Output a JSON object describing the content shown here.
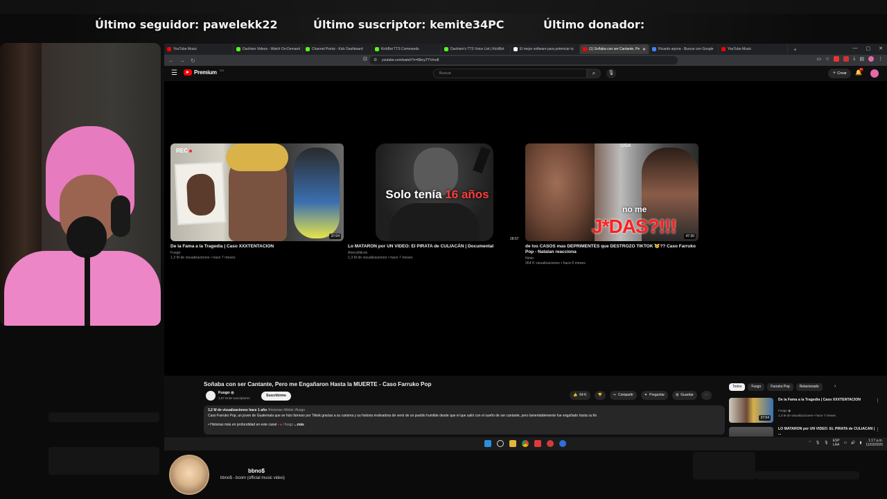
{
  "overlay": {
    "follower": "Último seguidor: pawelekk22",
    "subscriber": "Último suscriptor: kemite34PC",
    "donor": "Último donador:"
  },
  "browser": {
    "tabs": [
      {
        "label": "YouTube Music",
        "color": "#ff0000"
      },
      {
        "label": "Dashism Videos - Watch On-Demand",
        "color": "#53fc18"
      },
      {
        "label": "Channel Points - Kick Dashboard",
        "color": "#53fc18"
      },
      {
        "label": "KickBot TTS Commands",
        "color": "#53fc18"
      },
      {
        "label": "Dashism's TTS Voice List | KickBot",
        "color": "#53fc18"
      },
      {
        "label": "El mejor software para potenciar tu",
        "color": "#ffffff"
      },
      {
        "label": "(1) Soñaba con ser Cantante, Pe",
        "color": "#ff0000"
      },
      {
        "label": "Ricardo arjona - Buscar con Google",
        "color": "#4285f4"
      },
      {
        "label": "YouTube Music",
        "color": "#ff0000"
      }
    ],
    "active_tab": 6,
    "url": "youtube.com/watch?v=6lbcyTYVmo8"
  },
  "youtube": {
    "logo_text": "Premium",
    "logo_cc": "CO",
    "search_placeholder": "Buscar",
    "create_label": "Crear",
    "notif_count": "9+"
  },
  "end_cards": [
    {
      "title": "De la Fama a la Tragedia | Caso XXXTENTACION",
      "channel": "Fusgo",
      "meta": "1,3 M de visualizaciones • hace 7 meses",
      "duration": "37:04",
      "overlay_text": "REC"
    },
    {
      "title": "Lo MATARON por UN VIDEO: El PIRATA de CULIACÁN | Documental",
      "channel": "Anecdóticos",
      "meta": "1,3 M de visualizaciones • hace 7 meses",
      "duration": "28:57",
      "headline_a": "Solo tenía",
      "headline_b": "16 años"
    },
    {
      "title": "de los CASOS mas DEPRIMENTES que DESTROZO TIKTOK 😿?? Caso Farruko Pop - Natalan reacciona",
      "channel": "Ninto",
      "meta": "364 K visualizaciones • hace 6 meses",
      "duration": "47:30",
      "line1": "no me",
      "line2": "J*DAS?!!!",
      "badge": "USA"
    }
  ],
  "video": {
    "title": "Soñaba con ser Cantante, Pero me Engañaron Hasta la MUERTE - Caso Farruko Pop",
    "channel": "Fusgo",
    "subs": "1,67 M de suscriptores",
    "subscribe_label": "Suscribirme",
    "actions": [
      "64 K",
      "Compartir",
      "Preguntar",
      "Guardar"
    ],
    "desc_meta": "3,2 M de visualizaciones  hace 1 año",
    "desc_tags": "#historias #tiktok #fusgo",
    "desc_body": "Caso Farruko Pop, un joven de Guatemala que se hizo famoso por Tiktok gracias a su carisma y su historia motivadora de venir de un pueblo humilde desde que el que salió con el sueño de ser cantante, pero lamentablemente fue engañado hasta su fin",
    "desc_more_a": "• Historias más en profundidad en este canal -",
    "desc_more_b": "/ fusgo",
    "desc_more_c": "...más"
  },
  "sidebar": {
    "chips": [
      "Todos",
      "Fusgo",
      "Farruko Pop",
      "Relacionado"
    ],
    "related": [
      {
        "title": "De la Fama a la Tragedia | Caso XXXTENTACION",
        "channel": "Fusgo",
        "meta": "1,3 M de visualizaciones • hace 7 meses",
        "duration": "37:04"
      },
      {
        "title": "LO MATARON por UN VIDEO: EL PIRATA de CULIACÁN | ...",
        "channel": "",
        "meta": "",
        "duration": ""
      }
    ]
  },
  "taskbar": {
    "lang_a": "ESP",
    "lang_b": "LAA",
    "time": "1:17 a.m.",
    "date": "11/03/2026"
  },
  "now_playing": {
    "title": "bbno$",
    "subtitle": "bbno$ - boom (official music video)"
  }
}
